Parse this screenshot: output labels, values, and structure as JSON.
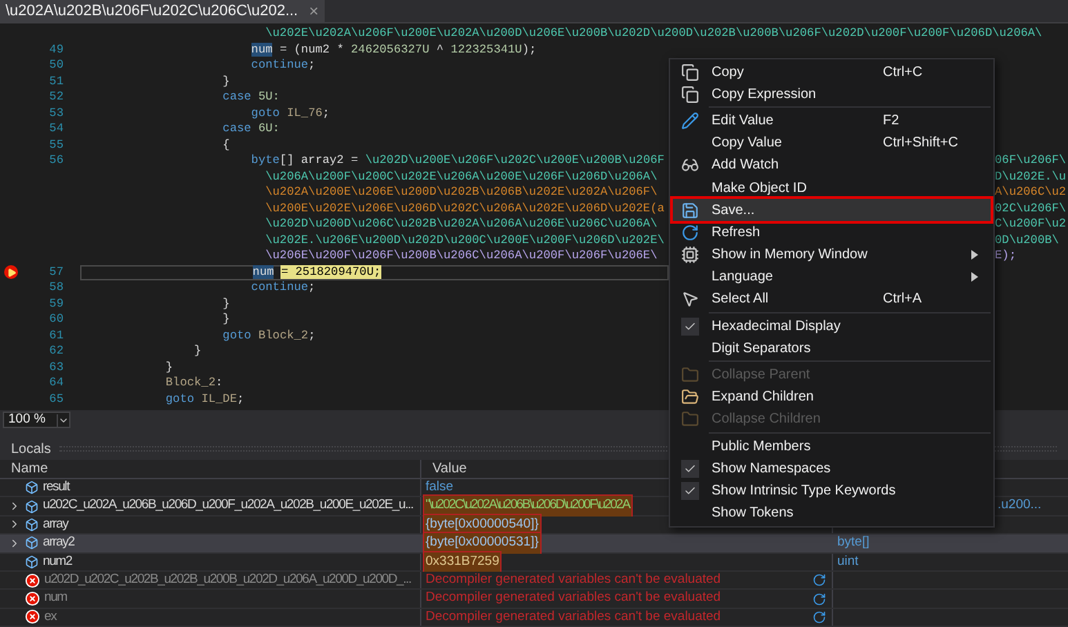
{
  "tab": {
    "title": "\\u202A\\u202B\\u206F\\u202C\\u206C\\u202...",
    "close": "×"
  },
  "code_lines": [
    {
      "breakpoint": false,
      "current": false,
      "segments": [
        {
          "text": "                          \\u202E\\u202A\\u206F\\u200E\\u202A\\u200D\\u206E\\u200B\\u202D\\u200D\\u202B\\u200B\\u206F\\u202D\\u200F\\u200F\\u206D\\u206A\\",
          "kind": "teal"
        }
      ]
    },
    {
      "number": "49",
      "breakpoint": false,
      "current": false,
      "segments": [
        {
          "text": "                        num",
          "kind": "selection"
        },
        {
          "text": " = (num2 * ",
          "kind": "plain"
        },
        {
          "text": "2462056327U",
          "kind": "number"
        },
        {
          "text": " ^ ",
          "kind": "plain"
        },
        {
          "text": "122325341U",
          "kind": "number"
        },
        {
          "text": ");",
          "kind": "plain"
        }
      ]
    },
    {
      "number": "50",
      "breakpoint": false,
      "current": false,
      "segments": [
        {
          "text": "                        continue",
          "kind": "keyword"
        },
        {
          "text": ";",
          "kind": "plain"
        }
      ]
    },
    {
      "number": "51",
      "breakpoint": false,
      "current": false,
      "segments": [
        {
          "text": "                    }",
          "kind": "plain"
        }
      ]
    },
    {
      "number": "52",
      "breakpoint": false,
      "current": false,
      "segments": [
        {
          "text": "                    case",
          "kind": "keyword"
        },
        {
          "text": " 5U:",
          "kind": "number"
        }
      ]
    },
    {
      "number": "53",
      "breakpoint": false,
      "current": false,
      "segments": [
        {
          "text": "                        goto",
          "kind": "keyword"
        },
        {
          "text": " IL_76",
          "kind": "label"
        },
        {
          "text": ";",
          "kind": "plain"
        }
      ]
    },
    {
      "number": "54",
      "breakpoint": false,
      "current": false,
      "segments": [
        {
          "text": "                    case",
          "kind": "keyword"
        },
        {
          "text": " 6U:",
          "kind": "number"
        }
      ]
    },
    {
      "number": "55",
      "breakpoint": false,
      "current": false,
      "segments": [
        {
          "text": "                    {",
          "kind": "plain"
        }
      ]
    },
    {
      "number": "56",
      "breakpoint": false,
      "current": false,
      "segments": [
        {
          "text": "                        byte",
          "kind": "keyword"
        },
        {
          "text": "[] array2 = ",
          "kind": "plain"
        },
        {
          "text": "\\u202D\\u200E\\u206F\\u202C\\u200E\\u200B\\u206F",
          "kind": "teal"
        }
      ],
      "tail": {
        "text": "06F\\u206F\\",
        "kind": "teal"
      }
    },
    {
      "breakpoint": false,
      "current": false,
      "segments": [
        {
          "text": "                          \\u206A\\u200F\\u200C\\u202E\\u206A\\u200E\\u206F\\u206D\\u206A\\",
          "kind": "teal"
        }
      ],
      "tail": {
        "text": "D\\u202E.\\u",
        "kind": "teal"
      }
    },
    {
      "breakpoint": false,
      "current": false,
      "segments": [
        {
          "text": "                          \\u202A\\u200E\\u206E\\u200D\\u202B\\u206B\\u202E\\u202A\\u206F\\",
          "kind": "orange"
        }
      ],
      "tail": {
        "text": "A\\u206C\\u2",
        "kind": "orange"
      }
    },
    {
      "breakpoint": false,
      "current": false,
      "segments": [
        {
          "text": "                          \\u200E\\u202E\\u206E\\u206D\\u202C\\u206A\\u202E\\u206D\\u202E(a",
          "kind": "orange"
        }
      ],
      "tail": {
        "text": "02C\\u206F\\",
        "kind": "teal"
      }
    },
    {
      "breakpoint": false,
      "current": false,
      "segments": [
        {
          "text": "                          \\u202D\\u200D\\u206C\\u202B\\u202A\\u206A\\u206E\\u206C\\u206A\\",
          "kind": "teal"
        }
      ],
      "tail": {
        "text": "C\\u200F\\u2",
        "kind": "teal"
      }
    },
    {
      "breakpoint": false,
      "current": false,
      "segments": [
        {
          "text": "                          \\u202E.\\u206E\\u200D\\u202D\\u200C\\u200E\\u200F\\u206D\\u202E\\",
          "kind": "teal"
        }
      ],
      "tail": {
        "text": "0D\\u200B\\",
        "kind": "teal"
      }
    },
    {
      "breakpoint": false,
      "current": false,
      "segments": [
        {
          "text": "                          \\u206E\\u200F\\u206F\\u200B\\u206C\\u206A\\u200F\\u206F\\u206E\\",
          "kind": "purple"
        }
      ],
      "tail": {
        "text": "E);",
        "kind": "purple"
      }
    },
    {
      "number": "57",
      "breakpoint": true,
      "current": true,
      "segments": [
        {
          "text": "                        num",
          "kind": "selection"
        },
        {
          "text": " = 2518209470U;",
          "kind": "statement"
        }
      ]
    },
    {
      "number": "58",
      "breakpoint": false,
      "current": false,
      "segments": [
        {
          "text": "                        continue",
          "kind": "keyword"
        },
        {
          "text": ";",
          "kind": "plain"
        }
      ]
    },
    {
      "number": "59",
      "breakpoint": false,
      "current": false,
      "segments": [
        {
          "text": "                    }",
          "kind": "plain"
        }
      ]
    },
    {
      "number": "60",
      "breakpoint": false,
      "current": false,
      "segments": [
        {
          "text": "                    }",
          "kind": "plain"
        }
      ]
    },
    {
      "number": "61",
      "breakpoint": false,
      "current": false,
      "segments": [
        {
          "text": "                    goto",
          "kind": "keyword"
        },
        {
          "text": " Block_2",
          "kind": "label"
        },
        {
          "text": ";",
          "kind": "plain"
        }
      ]
    },
    {
      "number": "62",
      "breakpoint": false,
      "current": false,
      "segments": [
        {
          "text": "                }",
          "kind": "plain"
        }
      ]
    },
    {
      "number": "63",
      "breakpoint": false,
      "current": false,
      "segments": [
        {
          "text": "            }",
          "kind": "plain"
        }
      ]
    },
    {
      "number": "64",
      "breakpoint": false,
      "current": false,
      "segments": [
        {
          "text": "            Block_2",
          "kind": "label"
        },
        {
          "text": ":",
          "kind": "plain"
        }
      ]
    },
    {
      "number": "65",
      "breakpoint": false,
      "current": false,
      "segments": [
        {
          "text": "            goto",
          "kind": "keyword"
        },
        {
          "text": " IL_DE",
          "kind": "label"
        },
        {
          "text": ";",
          "kind": "plain"
        }
      ]
    }
  ],
  "zoom": {
    "value": "100 %"
  },
  "locals": {
    "title": "Locals",
    "columns": [
      "Name",
      "Value"
    ],
    "rows": [
      {
        "kind": "field",
        "name": "result",
        "value": {
          "text": "false",
          "kind": "keyword"
        },
        "changed": false,
        "expandable": false,
        "selected": false
      },
      {
        "kind": "field",
        "name": "u202C_u202A_u206B_u206D_u200F_u202A_u202B_u200E_u202E_u...",
        "value": {
          "text": "\"\\u202C\\u202A\\u206B\\u206D\\u200F\\u202A",
          "kind": "string"
        },
        "changed": true,
        "type": ".u200...",
        "expandable": true,
        "selected": false
      },
      {
        "kind": "field",
        "name": "array",
        "value": {
          "text": "{byte[0x00000540]}",
          "kind": "object"
        },
        "changed": true,
        "expandable": true,
        "selected": false
      },
      {
        "kind": "field",
        "name": "array2",
        "value": {
          "text": "{byte[0x00000531]}",
          "kind": "object"
        },
        "changed": true,
        "type": "byte[]",
        "expandable": true,
        "selected": true
      },
      {
        "kind": "field",
        "name": "num2",
        "value": {
          "text": "0x331B7259",
          "kind": "number"
        },
        "changed": true,
        "type": "uint",
        "expandable": false,
        "selected": false
      },
      {
        "kind": "error",
        "name": "u202D_u202C_u202B_u202B_u200B_u202D_u206A_u200D_u200D_...",
        "value": {
          "text": "Decompiler generated variables can't be evaluated",
          "kind": "error"
        },
        "changed": false,
        "expandable": false,
        "selected": false
      },
      {
        "kind": "error",
        "name": "num",
        "value": {
          "text": "Decompiler generated variables can't be evaluated",
          "kind": "error"
        },
        "changed": false,
        "expandable": false,
        "selected": false
      },
      {
        "kind": "error",
        "name": "ex",
        "value": {
          "text": "Decompiler generated variables can't be evaluated",
          "kind": "error"
        },
        "changed": false,
        "expandable": false,
        "selected": false
      }
    ]
  },
  "context_menu": [
    {
      "kind": "item",
      "label": "Copy",
      "shortcut": "Ctrl+C",
      "selected": false,
      "checked": false,
      "disabled": false,
      "submenu": false
    },
    {
      "kind": "item",
      "label": "Copy Expression",
      "selected": false,
      "checked": false,
      "disabled": false,
      "submenu": false
    },
    {
      "kind": "separator"
    },
    {
      "kind": "item",
      "label": "Edit Value",
      "shortcut": "F2",
      "selected": false,
      "checked": false,
      "disabled": false,
      "submenu": false
    },
    {
      "kind": "item",
      "label": "Copy Value",
      "shortcut": "Ctrl+Shift+C",
      "selected": false,
      "checked": false,
      "disabled": false,
      "submenu": false
    },
    {
      "kind": "item",
      "label": "Add Watch",
      "selected": false,
      "checked": false,
      "disabled": false,
      "submenu": false
    },
    {
      "kind": "item",
      "label": "Make Object ID",
      "selected": false,
      "checked": false,
      "disabled": false,
      "submenu": false
    },
    {
      "kind": "item",
      "label": "Save...",
      "selected": true,
      "checked": false,
      "disabled": false,
      "submenu": false
    },
    {
      "kind": "item",
      "label": "Refresh",
      "selected": false,
      "checked": false,
      "disabled": false,
      "submenu": false
    },
    {
      "kind": "item",
      "label": "Show in Memory Window",
      "selected": false,
      "checked": false,
      "disabled": false,
      "submenu": true
    },
    {
      "kind": "item",
      "label": "Language",
      "selected": false,
      "checked": false,
      "disabled": false,
      "submenu": true
    },
    {
      "kind": "item",
      "label": "Select All",
      "shortcut": "Ctrl+A",
      "selected": false,
      "checked": false,
      "disabled": false,
      "submenu": false
    },
    {
      "kind": "separator"
    },
    {
      "kind": "item",
      "label": "Hexadecimal Display",
      "selected": false,
      "checked": true,
      "disabled": false,
      "submenu": false
    },
    {
      "kind": "item",
      "label": "Digit Separators",
      "selected": false,
      "checked": false,
      "disabled": false,
      "submenu": false
    },
    {
      "kind": "separator"
    },
    {
      "kind": "item",
      "label": "Collapse Parent",
      "selected": false,
      "checked": false,
      "disabled": true,
      "submenu": false
    },
    {
      "kind": "item",
      "label": "Expand Children",
      "selected": false,
      "checked": false,
      "disabled": false,
      "submenu": false
    },
    {
      "kind": "item",
      "label": "Collapse Children",
      "selected": false,
      "checked": false,
      "disabled": true,
      "submenu": false
    },
    {
      "kind": "separator"
    },
    {
      "kind": "item",
      "label": "Public Members",
      "selected": false,
      "checked": false,
      "disabled": false,
      "submenu": false
    },
    {
      "kind": "item",
      "label": "Show Namespaces",
      "selected": false,
      "checked": true,
      "disabled": false,
      "submenu": false
    },
    {
      "kind": "item",
      "label": "Show Intrinsic Type Keywords",
      "selected": false,
      "checked": true,
      "disabled": false,
      "submenu": false
    },
    {
      "kind": "item",
      "label": "Show Tokens",
      "selected": false,
      "checked": false,
      "disabled": false,
      "submenu": false
    }
  ]
}
